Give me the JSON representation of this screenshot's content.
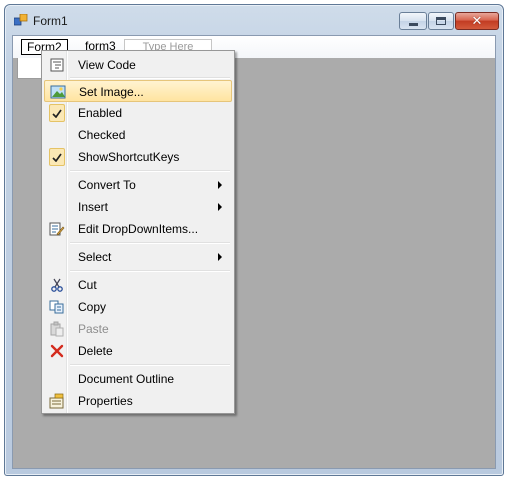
{
  "window": {
    "title": "Form1",
    "icon": "form-app-icon"
  },
  "menustrip": {
    "items": [
      {
        "label": "Form2"
      },
      {
        "label": "form3"
      }
    ],
    "type_here_placeholder": "Type Here"
  },
  "context_menu": {
    "items": [
      {
        "label": "View Code",
        "icon": "view-code-icon"
      },
      {
        "label": "Set Image...",
        "icon": "image-icon",
        "highlighted": true
      },
      {
        "label": "Enabled",
        "icon": "checkmark-icon",
        "checked": true
      },
      {
        "label": "Checked"
      },
      {
        "label": "ShowShortcutKeys",
        "icon": "checkmark-icon",
        "checked": true
      },
      {
        "label": "Convert To",
        "submenu": true
      },
      {
        "label": "Insert",
        "submenu": true
      },
      {
        "label": "Edit DropDownItems...",
        "icon": "edit-items-icon"
      },
      {
        "label": "Select",
        "submenu": true
      },
      {
        "label": "Cut",
        "icon": "scissors-icon"
      },
      {
        "label": "Copy",
        "icon": "copy-icon"
      },
      {
        "label": "Paste",
        "icon": "paste-icon",
        "disabled": true
      },
      {
        "label": "Delete",
        "icon": "delete-x-icon"
      },
      {
        "label": "Document Outline"
      },
      {
        "label": "Properties",
        "icon": "properties-icon"
      }
    ]
  },
  "colors": {
    "highlight": "#ffe4a0",
    "client_background": "#ababab",
    "delete_red": "#d42b1e"
  }
}
